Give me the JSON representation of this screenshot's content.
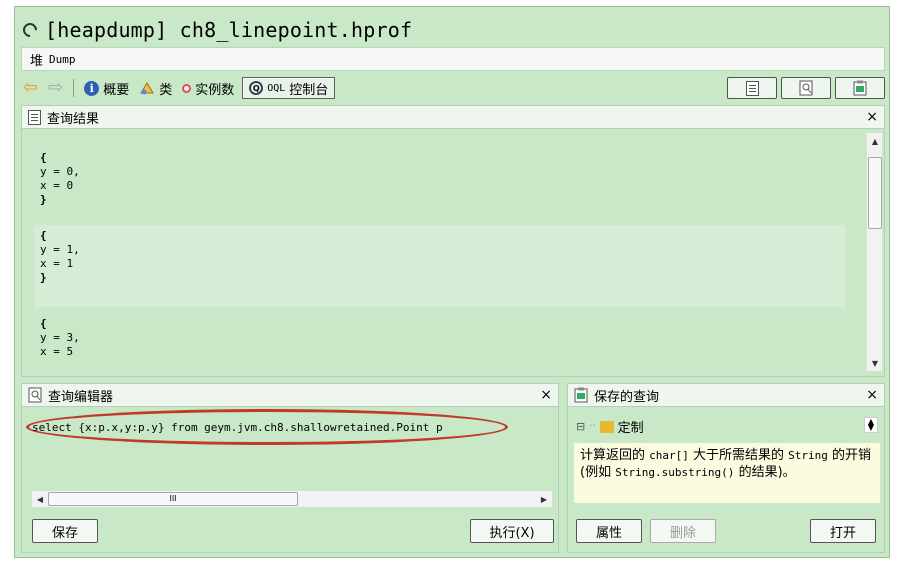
{
  "window": {
    "title": "[heapdump] ch8_linepoint.hprof"
  },
  "subbar": {
    "label": "堆",
    "sublabel": "Dump"
  },
  "toolbar": {
    "overview_label": "概要",
    "class_label": "类",
    "instances_label": "实例数",
    "oql_prefix": "OQL",
    "oql_label": "控制台"
  },
  "results_panel": {
    "title": "查询结果",
    "close_glyph": "×",
    "blocks": [
      {
        "open": "{",
        "line1": "y = 0,",
        "line2": "x = 0",
        "close": "}"
      },
      {
        "open": "{",
        "line1": "y = 1,",
        "line2": "x = 1",
        "close": "}"
      },
      {
        "open": "{",
        "line1": "y = 3,",
        "line2": "x = 5",
        "close": ""
      }
    ]
  },
  "editor_panel": {
    "title": "查询编辑器",
    "close_glyph": "×",
    "query": "select {x:p.x,y:p.y} from geym.jvm.ch8.shallowretained.Point p",
    "scroll_grip": "III",
    "save_label": "保存",
    "run_label": "执行(X)"
  },
  "saved_panel": {
    "title": "保存的查询",
    "close_glyph": "×",
    "tree_label": "定制",
    "description_parts": [
      "计算返回的 ",
      "char[]",
      " 大于所需结果的 ",
      "String",
      " 的开销 (例如 ",
      "String.substring()",
      " 的结果)。"
    ],
    "properties_label": "属性",
    "delete_label": "删除",
    "open_label": "打开"
  },
  "colors": {
    "background": "#c8e8c8",
    "highlight_row": "#d4edd4",
    "annotation_oval": "#c0392b",
    "description_bg": "#fbfbe0"
  }
}
